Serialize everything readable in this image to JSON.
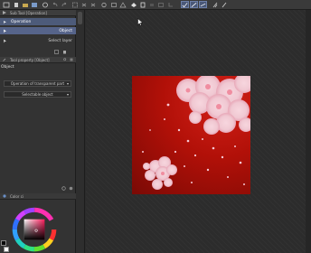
{
  "subtool_panel": {
    "title": "Sub Tool [Operation]",
    "items": [
      {
        "label": "Operation",
        "right": "",
        "selected": true
      },
      {
        "label": "",
        "right": "Object",
        "selected": true
      },
      {
        "label": "",
        "right": "Select layer",
        "selected": false
      }
    ]
  },
  "property_panel": {
    "title": "Tool property [Object]",
    "section": "Object",
    "dropdowns": [
      "Operation of transparent part",
      "Selectable object"
    ]
  },
  "color_panel": {
    "title": "Color ci"
  },
  "colors": {
    "accent": "#4d5b7a",
    "canvas_red": "#c4140c"
  },
  "icons": [
    "undo-icon",
    "redo-icon",
    "transform-icon",
    "fill-icon",
    "select-icon",
    "ruler-icon",
    "snap-icon"
  ]
}
